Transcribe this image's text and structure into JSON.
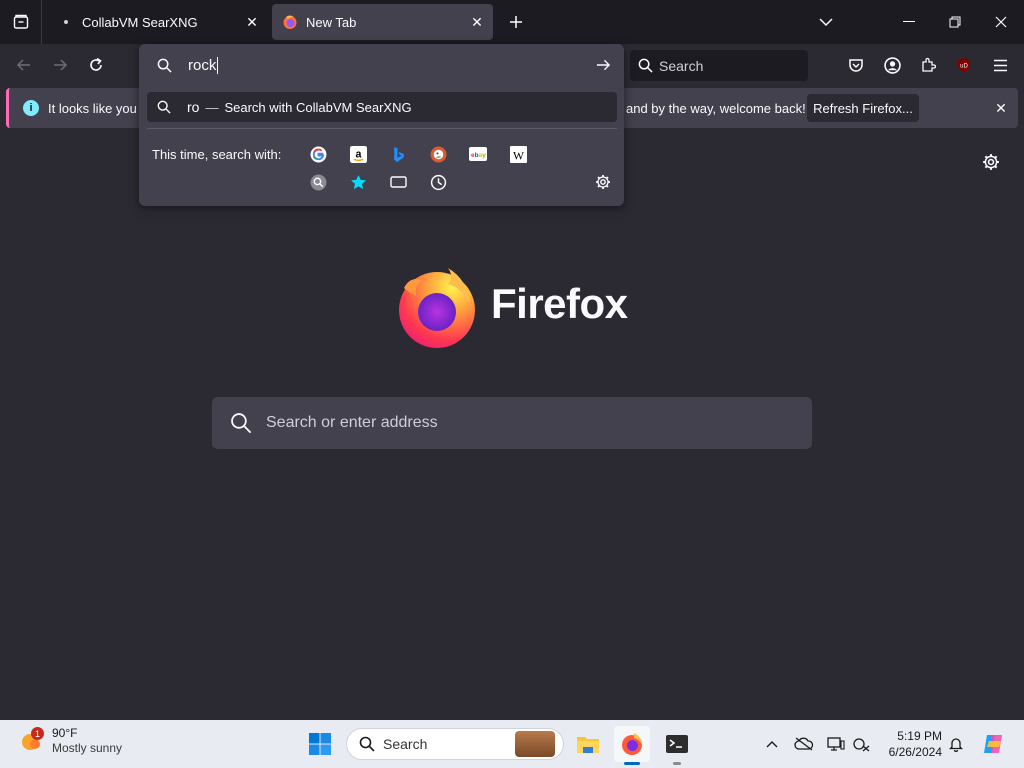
{
  "browser": {
    "tabs": [
      {
        "title": "CollabVM SearXNG",
        "active": false
      },
      {
        "title": "New Tab",
        "active": true
      }
    ],
    "nav_search_placeholder": "Search"
  },
  "notification": {
    "message_start": "It looks like you ha",
    "message_end": "and by the way, welcome back!",
    "refresh_label": "Refresh Firefox..."
  },
  "urlbar": {
    "typed_value": "rock",
    "suggestion_query": "ro",
    "suggestion_dash": "—",
    "suggestion_action": "Search with CollabVM SearXNG",
    "this_time_label": "This time, search with:",
    "engines": [
      "google-icon",
      "amazon-icon",
      "bing-icon",
      "duckduckgo-icon",
      "ebay-icon",
      "wikipedia-icon",
      "searxng-icon",
      "bookmarks-icon",
      "tabs-icon",
      "history-icon"
    ]
  },
  "newtab": {
    "wordmark": "Firefox",
    "search_placeholder": "Search or enter address"
  },
  "taskbar": {
    "weather_badge": "1",
    "temperature": "90°F",
    "condition": "Mostly sunny",
    "search_label": "Search",
    "time": "5:19 PM",
    "date": "6/26/2024"
  },
  "colors": {
    "accent": "#0067c0",
    "notif_stripe": "#ff6bba",
    "info": "#80ebff"
  }
}
